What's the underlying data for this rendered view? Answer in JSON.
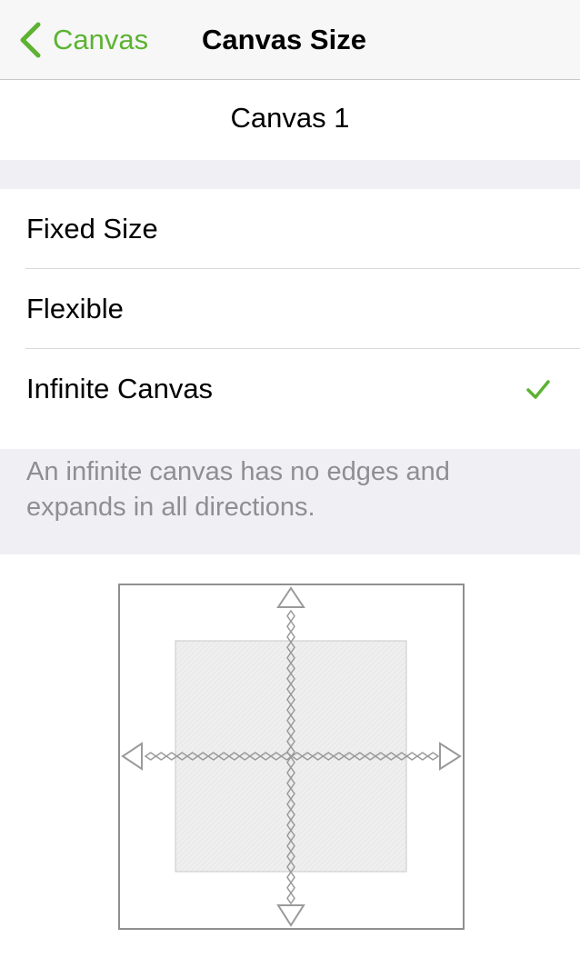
{
  "navbar": {
    "back_label": "Canvas",
    "title": "Canvas Size",
    "accent_color": "#5cb332",
    "back_icon": "chevron-left-icon"
  },
  "canvas": {
    "name": "Canvas 1"
  },
  "options": [
    {
      "label": "Fixed Size",
      "selected": false
    },
    {
      "label": "Flexible",
      "selected": false
    },
    {
      "label": "Infinite Canvas",
      "selected": true
    }
  ],
  "selected_icon": "checkmark-icon",
  "description": "An infinite canvas has no edges and expands in all directions.",
  "diagram_icon": "infinite-canvas-illustration"
}
